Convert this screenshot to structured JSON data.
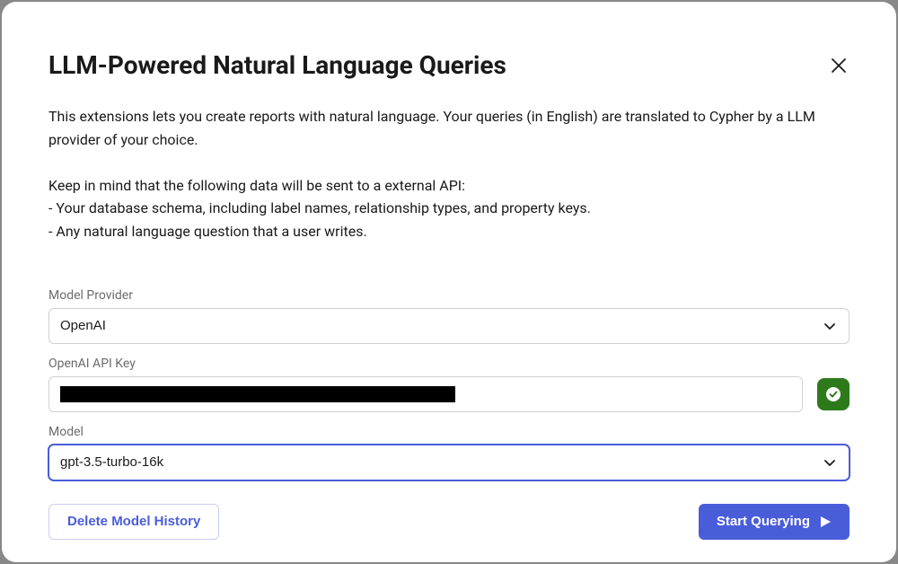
{
  "modal": {
    "title": "LLM-Powered Natural Language Queries",
    "description": "This extensions lets you create reports with natural language. Your queries (in English) are translated to Cypher by a LLM provider of your choice.\n\nKeep in mind that the following data will be sent to a external API:\n- Your database schema, including label names, relationship types, and property keys.\n- Any natural language question that a user writes."
  },
  "form": {
    "provider_label": "Model Provider",
    "provider_value": "OpenAI",
    "apikey_label": "OpenAI API Key",
    "model_label": "Model",
    "model_value": "gpt-3.5-turbo-16k"
  },
  "buttons": {
    "delete_history": "Delete Model History",
    "start_querying": "Start Querying"
  }
}
